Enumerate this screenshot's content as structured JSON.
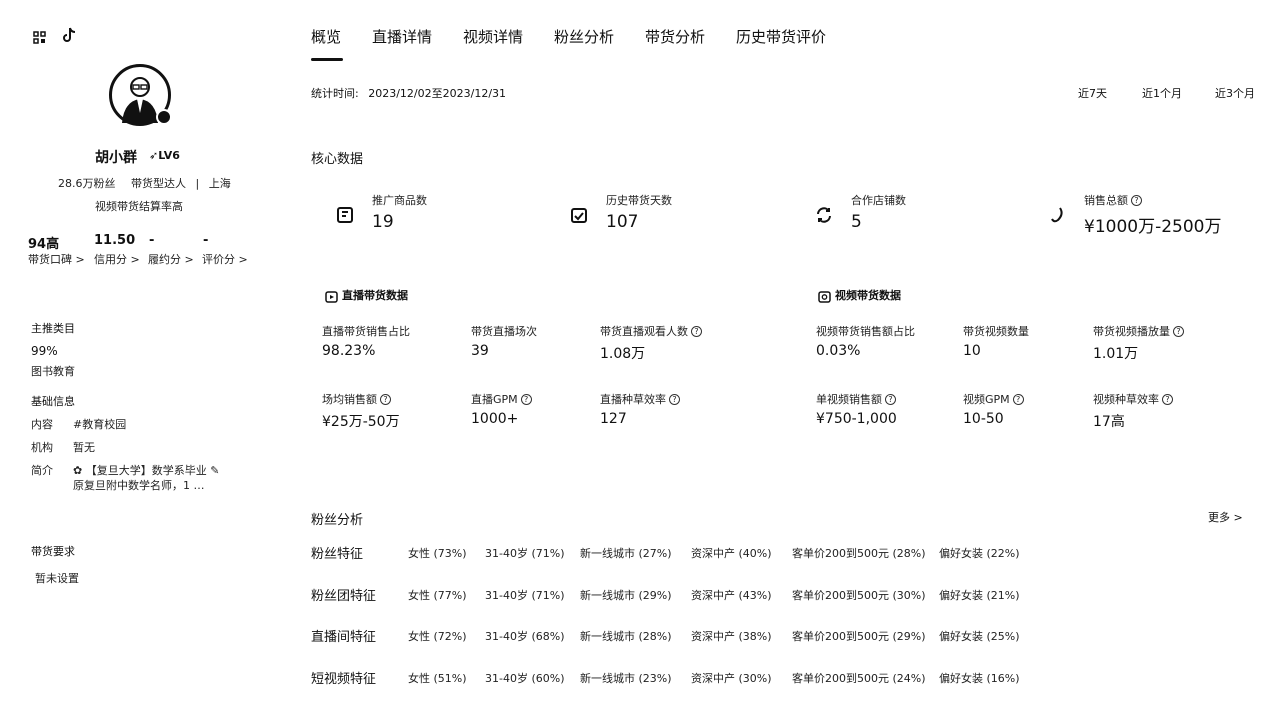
{
  "top_icons": [
    {
      "name": "grid-icon"
    },
    {
      "name": "tiktok-icon"
    }
  ],
  "profile": {
    "name": "胡小群",
    "level": "LV6",
    "fans": "28.6万粉丝",
    "type": "带货型达人",
    "divider": "|",
    "location": "上海",
    "note": "视频带货结算率高",
    "stats": [
      {
        "value": "94高",
        "label": "带货口碑 >"
      },
      {
        "value": "11.50",
        "label": "信用分 >"
      },
      {
        "value": "-",
        "label": "履约分 >"
      },
      {
        "value": "-",
        "label": "评价分 >"
      }
    ]
  },
  "main_category": {
    "title": "主推类目",
    "percent": "99%",
    "name": "图书教育"
  },
  "basic_info": {
    "title": "基础信息",
    "rows": [
      {
        "label": "内容",
        "value": "#教育校园"
      },
      {
        "label": "机构",
        "value": "暂无"
      },
      {
        "label": "简介",
        "value": "【复旦大学】数学系毕业",
        "value2": "原复旦附中数学名师，1 …"
      }
    ]
  },
  "requirements": {
    "title": "带货要求",
    "value": "暂未设置"
  },
  "tabs": [
    "概览",
    "直播详情",
    "视频详情",
    "粉丝分析",
    "带货分析",
    "历史带货评价"
  ],
  "date_range": {
    "label": "统计时间:",
    "value": "2023/12/02至2023/12/31"
  },
  "range_buttons": [
    "近7天",
    "近1个月",
    "近3个月"
  ],
  "core": {
    "title": "核心数据",
    "kpis": [
      {
        "label": "推广商品数",
        "value": "19"
      },
      {
        "label": "历史带货天数",
        "value": "107"
      },
      {
        "label": "合作店铺数",
        "value": "5"
      },
      {
        "label": "销售总额",
        "value": "¥1000万-2500万"
      }
    ]
  },
  "live": {
    "title": "直播带货数据",
    "metrics": [
      {
        "label": "直播带货销售占比",
        "value": "98.23%",
        "help": false
      },
      {
        "label": "带货直播场次",
        "value": "39",
        "help": false
      },
      {
        "label": "带货直播观看人数",
        "value": "1.08万",
        "help": true
      },
      {
        "label": "场均销售额",
        "value": "¥25万-50万",
        "help": true
      },
      {
        "label": "直播GPM",
        "value": "1000+",
        "help": true
      },
      {
        "label": "直播种草效率",
        "value": "127",
        "help": true
      }
    ]
  },
  "video": {
    "title": "视频带货数据",
    "metrics": [
      {
        "label": "视频带货销售额占比",
        "value": "0.03%",
        "help": false
      },
      {
        "label": "带货视频数量",
        "value": "10",
        "help": false
      },
      {
        "label": "带货视频播放量",
        "value": "1.01万",
        "help": true
      },
      {
        "label": "单视频销售额",
        "value": "¥750-1,000",
        "help": true
      },
      {
        "label": "视频GPM",
        "value": "10-50",
        "help": true
      },
      {
        "label": "视频种草效率",
        "value": "17高",
        "help": true
      }
    ]
  },
  "fans": {
    "title": "粉丝分析",
    "more": "更多 >",
    "rows": [
      {
        "label": "粉丝特征",
        "cells": [
          "女性 (73%)",
          "31-40岁 (71%)",
          "新一线城市 (27%)",
          "资深中产 (40%)",
          "客单价200到500元 (28%)",
          "偏好女装 (22%)"
        ]
      },
      {
        "label": "粉丝团特征",
        "cells": [
          "女性 (77%)",
          "31-40岁 (71%)",
          "新一线城市 (29%)",
          "资深中产 (43%)",
          "客单价200到500元 (30%)",
          "偏好女装 (21%)"
        ]
      },
      {
        "label": "直播间特征",
        "cells": [
          "女性 (72%)",
          "31-40岁 (68%)",
          "新一线城市 (28%)",
          "资深中产 (38%)",
          "客单价200到500元 (29%)",
          "偏好女装 (25%)"
        ]
      },
      {
        "label": "短视频特征",
        "cells": [
          "女性 (51%)",
          "31-40岁 (60%)",
          "新一线城市 (23%)",
          "资深中产 (30%)",
          "客单价200到500元 (24%)",
          "偏好女装 (16%)"
        ]
      }
    ]
  }
}
